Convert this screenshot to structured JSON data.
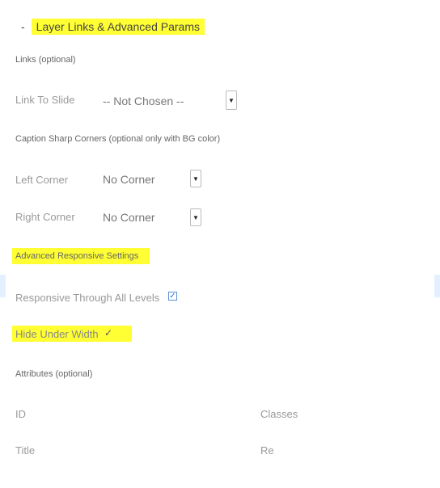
{
  "section": {
    "dash": "-",
    "title": "Layer Links & Advanced Params"
  },
  "links": {
    "heading": "Links (optional)",
    "link_to_slide": {
      "label": "Link To Slide",
      "value": "-- Not Chosen --"
    }
  },
  "corners": {
    "heading": "Caption Sharp Corners (optional only with BG color)",
    "left": {
      "label": "Left Corner",
      "value": "No Corner"
    },
    "right": {
      "label": "Right Corner",
      "value": "No Corner"
    }
  },
  "responsive": {
    "heading": "Advanced Responsive Settings",
    "through_all_levels": {
      "label": "Responsive Through All Levels",
      "checked": true
    },
    "hide_under_width": {
      "label": "Hide Under Width",
      "checked": true
    }
  },
  "attributes": {
    "heading": "Attributes (optional)",
    "id_label": "ID",
    "classes_label": "Classes",
    "title_label": "Title",
    "rel_label": "Re"
  },
  "icons": {
    "dropdown": "dropdown-arrow-icon",
    "check": "checkmark-icon"
  },
  "colors": {
    "highlight": "#ffff33",
    "checkbox_border": "#5a8fd8"
  }
}
